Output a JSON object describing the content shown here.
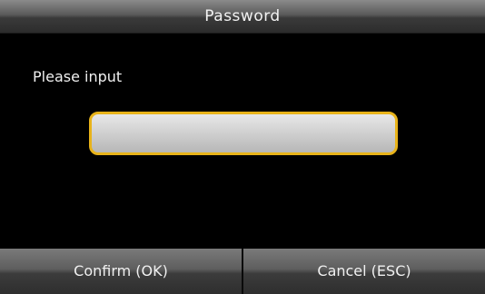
{
  "dialog": {
    "title": "Password",
    "prompt": "Please input",
    "input_value": ""
  },
  "buttons": {
    "confirm_label": "Confirm (OK)",
    "cancel_label": "Cancel (ESC)"
  },
  "colors": {
    "accent_border": "#e8b31a",
    "background": "#000000"
  }
}
